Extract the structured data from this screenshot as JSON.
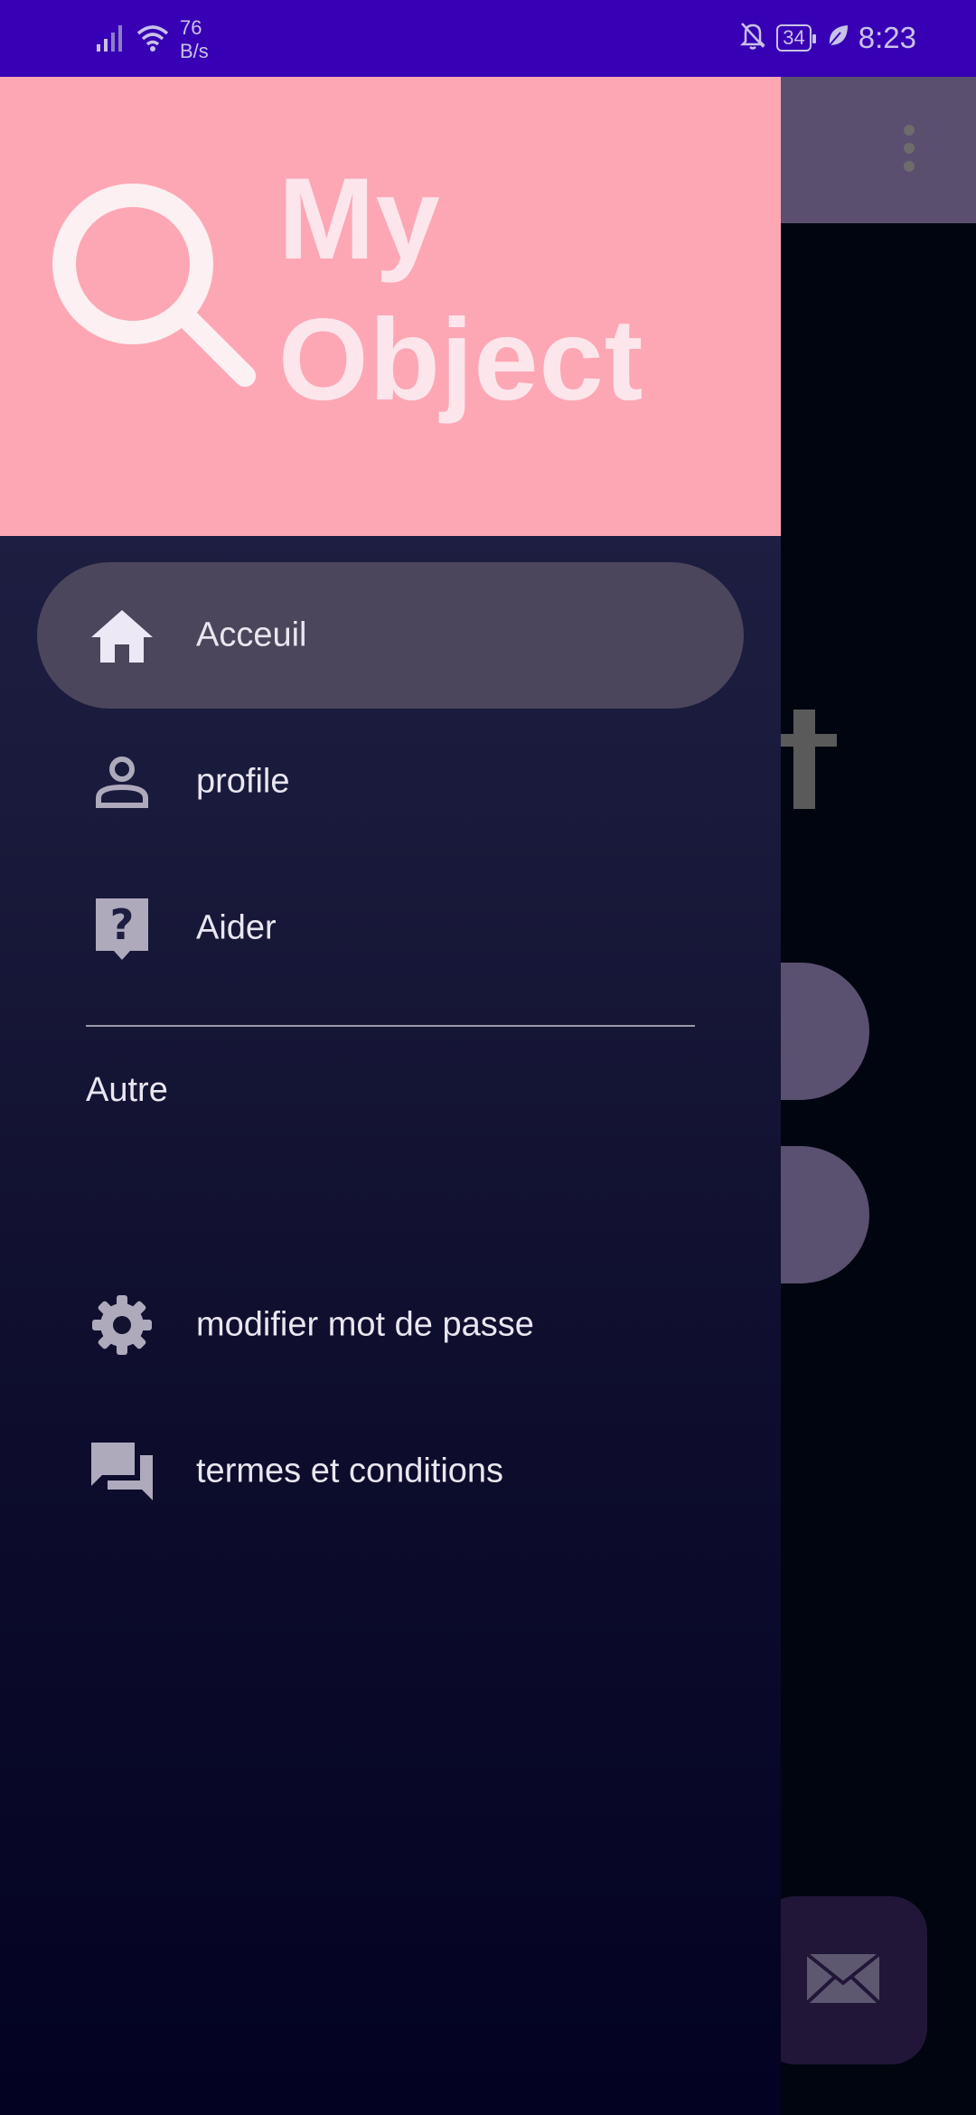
{
  "status_bar": {
    "net_speed_value": "76",
    "net_speed_unit": "B/s",
    "battery": "34",
    "time": "8:23"
  },
  "drawer": {
    "header": {
      "title_line1": "My",
      "title_line2": "Object"
    },
    "items": [
      {
        "label": "Acceuil",
        "icon": "home-icon",
        "active": true
      },
      {
        "label": "profile",
        "icon": "person-icon",
        "active": false
      },
      {
        "label": "Aider",
        "icon": "help-icon",
        "active": false
      }
    ],
    "section_title": "Autre",
    "section_items": [
      {
        "label": "modifier mot de passe",
        "icon": "gear-icon"
      },
      {
        "label": "termes et conditions",
        "icon": "forum-icon"
      }
    ]
  },
  "colors": {
    "status_bar": "#3800b4",
    "header_bg": "#fda7b5",
    "active_item_bg": "#4b465b",
    "icon_color": "#aeaabc"
  }
}
